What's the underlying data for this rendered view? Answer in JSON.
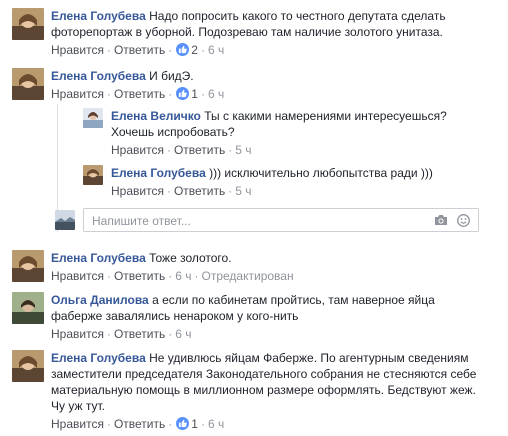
{
  "labels": {
    "like": "Нравится",
    "reply": "Ответить",
    "sep": "·"
  },
  "reply_box": {
    "placeholder": "Напишите ответ..."
  },
  "comments": [
    {
      "author": "Елена Голубева",
      "text": "Надо попросить какого то честного депутата сделать фоторепортаж в уборной. Подозреваю там наличие золотого унитаза.",
      "likes": "2",
      "time": "6 ч"
    },
    {
      "author": "Елена Голубева",
      "text": "И бидЭ.",
      "likes": "1",
      "time": "6 ч",
      "replies": [
        {
          "author": "Елена Величко",
          "text": "Ты с какими намерениями интересуешься?Хочешь испробовать?",
          "time": "5 ч"
        },
        {
          "author": "Елена Голубева",
          "text": "))) исключительно любопытства ради )))",
          "time": "5 ч"
        }
      ]
    },
    {
      "author": "Елена Голубева",
      "text": "Тоже золотого.",
      "time": "6 ч",
      "edited": "Отредактирован"
    },
    {
      "author": "Ольга Данилова",
      "text": "а если по кабинетам пройтись, там наверное яйца фаберже завалялись ненароком у кого-нить",
      "time": "6 ч"
    },
    {
      "author": "Елена Голубева",
      "text": "Не удивлюсь яйцам Фаберже. По агентурным сведениям заместители председателя Законодательного собрания не стесняются себе материальную помощь в миллионном размере оформлять. Бедствуют жеж. Чу уж тут.",
      "likes": "1",
      "time": "6 ч"
    }
  ]
}
